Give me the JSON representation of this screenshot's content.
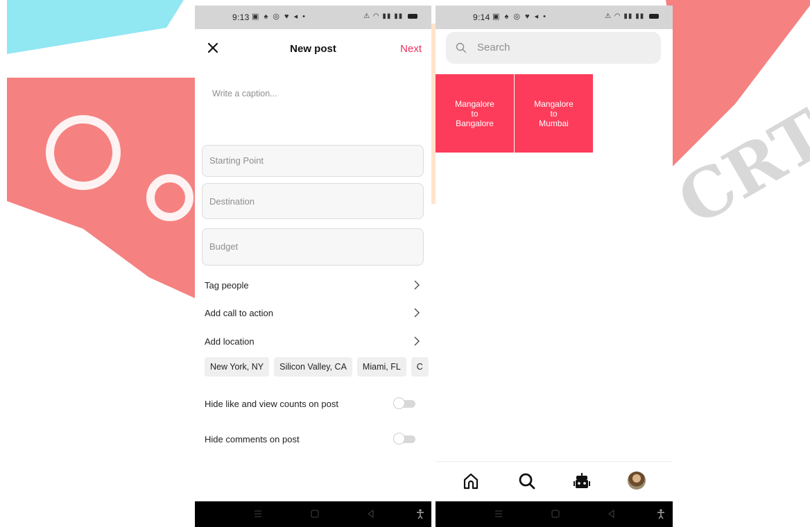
{
  "watermark": {
    "text": "IJCRT",
    "colors": {
      "red": "#f36b6b",
      "cyan": "#7ee3f0",
      "orange": "#ffd0a8"
    }
  },
  "left_phone": {
    "status": {
      "time": "9:13"
    },
    "header": {
      "title": "New post",
      "next_label": "Next",
      "close_icon": "close-icon"
    },
    "caption_placeholder": "Write a caption...",
    "fields": {
      "starting_point": "Starting Point",
      "destination": "Destination",
      "budget": "Budget"
    },
    "rows": {
      "tag_people": "Tag people",
      "call_to_action": "Add call to action",
      "location": "Add location"
    },
    "location_chips": [
      "New York, NY",
      "Silicon Valley, CA",
      "Miami, FL",
      "C"
    ],
    "toggles": {
      "hide_counts": {
        "label": "Hide like and view counts on post",
        "on": false
      },
      "hide_comments": {
        "label": "Hide comments on post",
        "on": false
      }
    },
    "accent_color": "#e8315d"
  },
  "right_phone": {
    "status": {
      "time": "9:14"
    },
    "search": {
      "placeholder": "Search"
    },
    "tiles": [
      {
        "lines": [
          "Mangalore",
          "to",
          "Bangalore"
        ]
      },
      {
        "lines": [
          "Mangalore",
          "to",
          "Mumbai"
        ]
      }
    ],
    "tile_color": "#fd3c5b",
    "tabs": [
      "home-icon",
      "search-icon",
      "bot-icon",
      "profile-avatar"
    ]
  }
}
